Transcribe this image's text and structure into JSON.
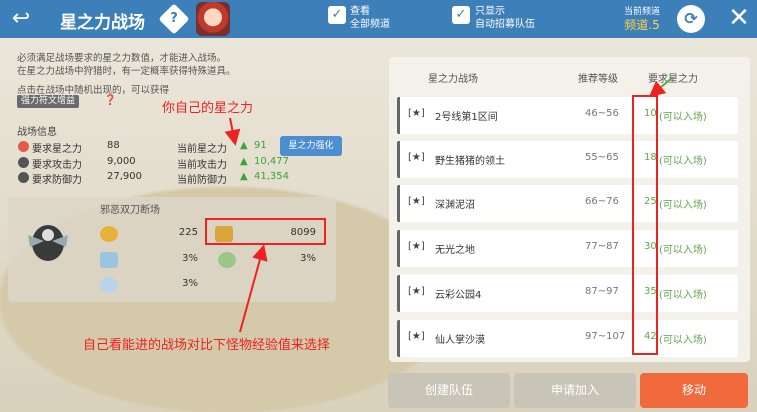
{
  "header": {
    "title": "星之力战场",
    "check1_line1": "查看",
    "check1_line2": "全部频道",
    "check2_line1": "只显示",
    "check2_line2": "自动招募队伍",
    "channel_label": "当前频道",
    "channel_value": "频道.5"
  },
  "info": {
    "desc_line1": "必须满足战场要求的星之力数值，才能进入战场。",
    "desc_line2": "在星之力战场中狩猎时，有一定概率获得特殊道具。",
    "get_line": "点击在战场中随机出现的，可以获得",
    "buff_tag": "强力符文增益",
    "section_label": "战场信息",
    "rows": [
      {
        "label": "要求星之力",
        "value": "88",
        "cur_label": "当前星之力",
        "cur_value": "91"
      },
      {
        "label": "要求攻击力",
        "value": "9,000",
        "cur_label": "当前攻击力",
        "cur_value": "10,477"
      },
      {
        "label": "要求防御力",
        "value": "27,900",
        "cur_label": "当前防御力",
        "cur_value": "41,354"
      }
    ],
    "enhance_label": "星之力强化"
  },
  "monster": {
    "name": "邪恶双刀断场",
    "stat1": "225",
    "stat2": "8099",
    "stat3": "3%",
    "stat4": "3%",
    "stat5": "3%"
  },
  "annotations": {
    "star_force": "你自己的星之力",
    "bottom": "自己看能进的战场对比下怪物经验值来选择"
  },
  "list": {
    "col_name": "星之力战场",
    "col_level": "推荐等级",
    "col_req": "要求星之力",
    "rows": [
      {
        "star": "[★]",
        "name": "2号线第1区间",
        "level": "46~56",
        "req": "10",
        "ok": "(可以入场)"
      },
      {
        "star": "[★]",
        "name": "野生猪猪的领土",
        "level": "55~65",
        "req": "18",
        "ok": "(可以入场)"
      },
      {
        "star": "[★]",
        "name": "深渊泥沼",
        "level": "66~76",
        "req": "25",
        "ok": "(可以入场)"
      },
      {
        "star": "[★]",
        "name": "无光之地",
        "level": "77~87",
        "req": "30",
        "ok": "(可以入场)"
      },
      {
        "star": "[★]",
        "name": "云彩公园4",
        "level": "87~97",
        "req": "35",
        "ok": "(可以入场)"
      },
      {
        "star": "[★]",
        "name": "仙人掌沙漠",
        "level": "97~107",
        "req": "42",
        "ok": "(可以入场)"
      }
    ]
  },
  "buttons": {
    "create": "创建队伍",
    "apply": "申请加入",
    "move": "移动"
  },
  "colors": {
    "header_bg": "#3d7fb8",
    "annotation": "#e22222",
    "move_button": "#f06a3c",
    "ok_green": "#5fa84a"
  }
}
